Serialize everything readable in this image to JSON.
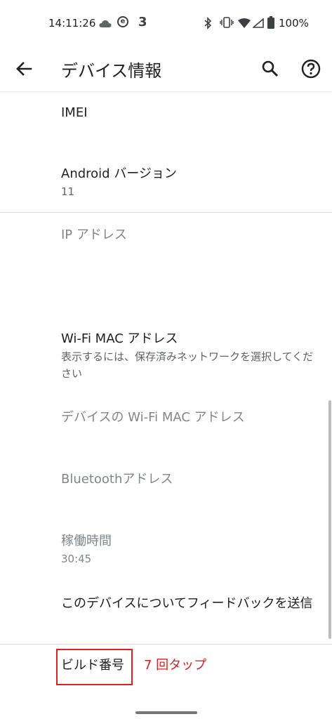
{
  "status_bar": {
    "time": "14:11:26",
    "notification_count": "3",
    "battery_percent": "100%",
    "icons": [
      "cloud-icon",
      "e-app-icon",
      "bluetooth-icon",
      "vibrate-icon",
      "wifi-icon",
      "signal-icon",
      "battery-icon"
    ]
  },
  "app_bar": {
    "title": "デバイス情報",
    "icons": [
      "back-arrow-icon",
      "search-icon",
      "help-icon"
    ]
  },
  "items": {
    "imei": {
      "title": "IMEI"
    },
    "android_version": {
      "title": "Android バージョン",
      "summary": "11"
    },
    "ip_address": {
      "title": "IP アドレス"
    },
    "wifi_mac": {
      "title": "Wi-Fi MAC アドレス",
      "summary": "表示するには、保存済みネットワークを選択してください"
    },
    "device_wifi_mac": {
      "title": "デバイスの Wi-Fi MAC アドレス"
    },
    "bluetooth": {
      "title": "Bluetoothアドレス"
    },
    "uptime": {
      "title": "稼働時間",
      "summary": "30:45"
    },
    "feedback": {
      "title": "このデバイスについてフィードバックを送信"
    },
    "build_number": {
      "title": "ビルド番号"
    }
  },
  "annotation": {
    "tap_note": "7 回タップ",
    "color": "#e02020"
  },
  "colors": {
    "text_primary": "#202124",
    "text_secondary": "#5f6368",
    "text_disabled": "#80868b",
    "divider": "#dadce0"
  }
}
